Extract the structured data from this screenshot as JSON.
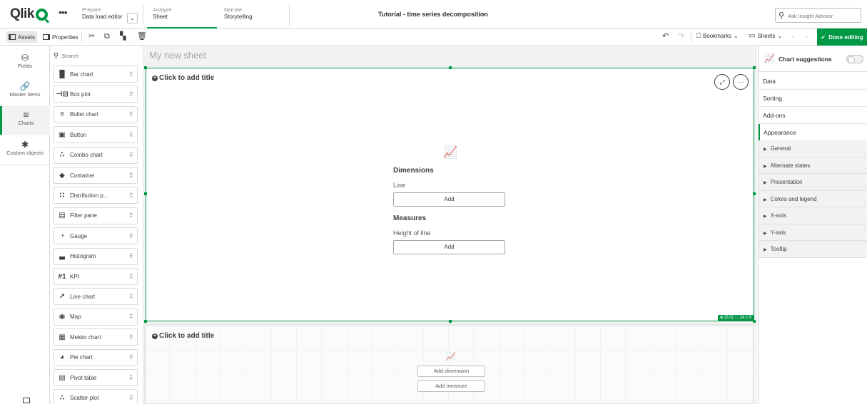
{
  "nav": {
    "logo": "Qlik",
    "prepare": {
      "small": "Prepare",
      "big": "Data load editor"
    },
    "analyze": {
      "small": "Analyze",
      "big": "Sheet"
    },
    "narrate": {
      "small": "Narrate",
      "big": "Storytelling"
    },
    "app_title": "Tutorial - time series decomposition",
    "insight_placeholder": "Ask Insight Advisor"
  },
  "toolbar": {
    "assets": "Assets",
    "properties": "Properties",
    "bookmarks": "Bookmarks",
    "sheets": "Sheets",
    "done": "Done editing"
  },
  "rail": {
    "items": [
      {
        "label": "Fields",
        "icon": "database-icon"
      },
      {
        "label": "Master items",
        "icon": "link-icon"
      },
      {
        "label": "Charts",
        "icon": "bar-chart-icon"
      },
      {
        "label": "Custom objects",
        "icon": "puzzle-icon"
      }
    ]
  },
  "assets": {
    "search_placeholder": "Search",
    "charts": [
      {
        "label": "Bar chart",
        "glyph": "▐▌"
      },
      {
        "label": "Box plot",
        "glyph": "⊣⊟"
      },
      {
        "label": "Bullet chart",
        "glyph": "≡"
      },
      {
        "label": "Button",
        "glyph": "▣"
      },
      {
        "label": "Combo chart",
        "glyph": "∴"
      },
      {
        "label": "Container",
        "glyph": "◆"
      },
      {
        "label": "Distribution p...",
        "glyph": "∷"
      },
      {
        "label": "Filter pane",
        "glyph": "▤"
      },
      {
        "label": "Gauge",
        "glyph": "◔"
      },
      {
        "label": "Histogram",
        "glyph": "▃"
      },
      {
        "label": "KPI",
        "glyph": "#1"
      },
      {
        "label": "Line chart",
        "glyph": "↗"
      },
      {
        "label": "Map",
        "glyph": "◉"
      },
      {
        "label": "Mekko chart",
        "glyph": "▦"
      },
      {
        "label": "Pie chart",
        "glyph": "◕"
      },
      {
        "label": "Pivot table",
        "glyph": "▤"
      },
      {
        "label": "Scatter plot",
        "glyph": "∴"
      }
    ]
  },
  "sheet": {
    "title": "My new sheet",
    "obj1": {
      "title": "Click to add title",
      "dimensions_heading": "Dimensions",
      "dimension_label": "Line",
      "measures_heading": "Measures",
      "measure_label": "Height of line",
      "add": "Add",
      "position": "⊕ (0,0) ⬚ 24 x 9"
    },
    "obj2": {
      "title": "Click to add title",
      "add_dimension": "Add dimension",
      "add_measure": "Add measure"
    }
  },
  "props": {
    "heading": "Chart suggestions",
    "tabs": [
      "Data",
      "Sorting",
      "Add-ons",
      "Appearance"
    ],
    "sections": [
      "General",
      "Alternate states",
      "Presentation",
      "Colors and legend",
      "X-axis",
      "Y-axis",
      "Tooltip"
    ]
  },
  "colors": {
    "accent": "#009845"
  }
}
